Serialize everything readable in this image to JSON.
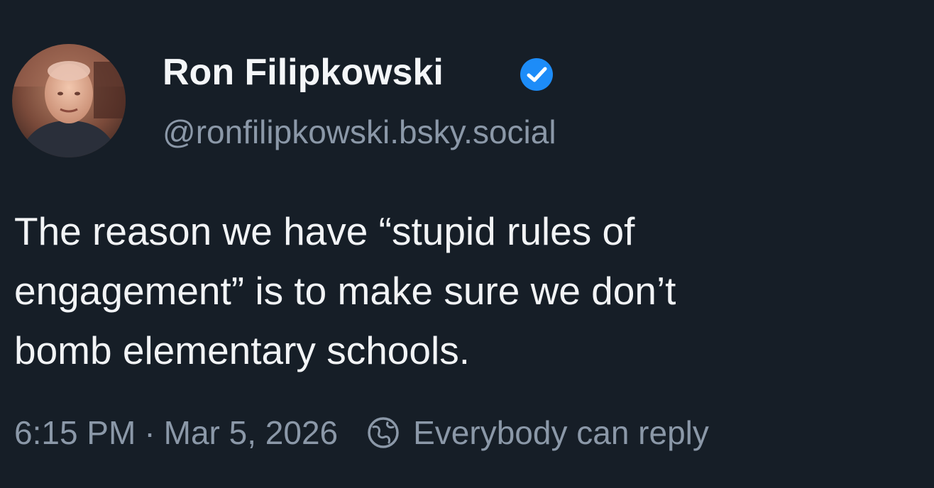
{
  "author": {
    "display_name": "Ron Filipkowski",
    "handle": "@ronfilipkowski.bsky.social",
    "verified": true,
    "verified_color": "#1d8cf8"
  },
  "post": {
    "text_lines": [
      "The reason we have “stupid rules of",
      "engagement” is to make sure we don’t",
      "bomb elementary schools."
    ]
  },
  "meta": {
    "time": "6:15 PM",
    "separator": "·",
    "date": "Mar 5, 2026",
    "reply_icon": "globe-icon",
    "reply_setting": "Everybody can reply"
  },
  "colors": {
    "background": "#161e27",
    "text_primary": "#f2f4f6",
    "text_secondary": "#8b98a8"
  }
}
